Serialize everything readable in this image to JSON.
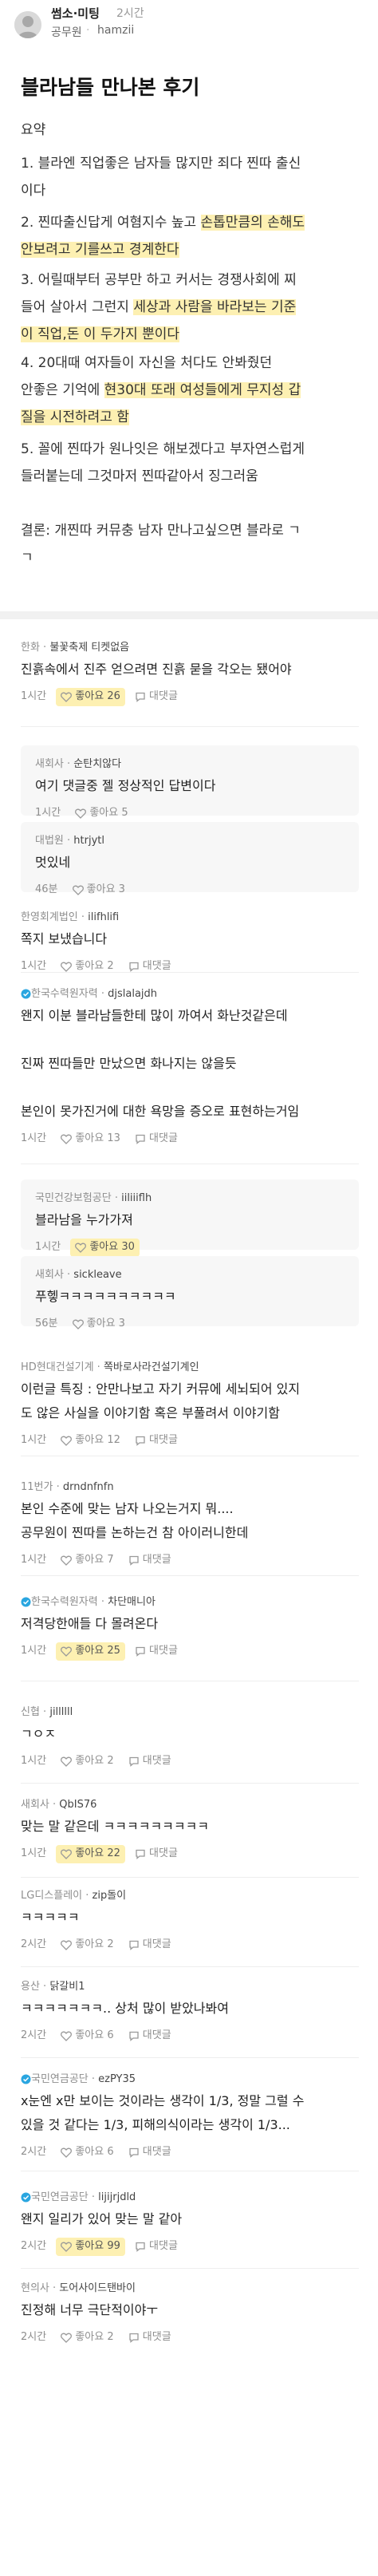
{
  "header": {
    "board": "썸소·미팅",
    "time": "2시간",
    "author_company": "공무원",
    "author_dot": "·",
    "author_name": "hamzii"
  },
  "post": {
    "title": "블라남들 만나본 후기",
    "summary_label": "요약",
    "lines": [
      "1. 블라엔 직업좋은 남자들 많지만 죄다 찐따 출신",
      "이다",
      "2. 찐따출신답게 여혐지수 높고 손톱만큼의 손해도",
      "안보려고 기를쓰고 경계한다",
      "3. 어릴때부터 공부만 하고 커서는 경쟁사회에 찌",
      "들어 살아서 그런지 세상과 사람을 바라보는 기준",
      "이 직업,돈 이 두가지 뿐이다",
      "4. 20대때 여자들이 자신을 처다도 안봐줬던",
      "안좋은 기억에 현30대 또래 여성들에게 무지성 갑",
      "질을 시전하려고 함",
      "5. 꼴에 찐따가 원나잇은 해보겠다고 부자연스럽게",
      "들러붙는데 그것마저 찐따같아서 징그러움",
      "",
      "결론: 개찐따 커뮤충 남자 만나고싶으면 블라로 ㄱ",
      "ㄱ"
    ]
  },
  "comments": [
    {
      "company": "한화",
      "name": "불꽃축제 티켓없음",
      "lines": [
        "진흙속에서 진주 얻으려면 진흙 묻을 각오는 됐어야"
      ],
      "time": "1시간",
      "likes": "좋아요 26",
      "liked": true,
      "reply": "대댓글",
      "is_reply": false
    },
    {
      "company": "새회사",
      "name": "순탄치않다",
      "lines": [
        "여기 댓글중 젤 정상적인 답변이다"
      ],
      "time": "1시간",
      "likes": "좋아요 5",
      "liked": false,
      "reply": "",
      "is_reply": true
    },
    {
      "company": "대법원",
      "name": "htrjytl",
      "lines": [
        "멋있네"
      ],
      "time": "46분",
      "likes": "좋아요 3",
      "liked": false,
      "reply": "",
      "is_reply": true
    },
    {
      "company": "한영회계법인",
      "name": "ilifhlifi",
      "lines": [
        "쪽지 보냈습니다"
      ],
      "time": "1시간",
      "likes": "좋아요 2",
      "liked": false,
      "reply": "대댓글",
      "is_reply": false
    },
    {
      "company": "한국수력원자력",
      "name": "djslalajdh",
      "lines": [
        "왠지 이분 블라남들한테 많이 까여서 화난것같은데",
        "",
        "진짜 찐따들만 만났으면 화나지는 않을듯",
        "",
        "본인이 못가진거에 대한 욕망을 증오로 표현하는거임"
      ],
      "time": "1시간",
      "likes": "좋아요 13",
      "liked": false,
      "reply": "대댓글",
      "is_reply": false
    },
    {
      "company": "국민건강보험공단",
      "name": "iiliiiflh",
      "lines": [
        "블라남을 누가가져"
      ],
      "time": "1시간",
      "likes": "좋아요 30",
      "liked": true,
      "reply": "",
      "is_reply": true
    },
    {
      "company": "새회사",
      "name": "sickleave",
      "lines": [
        "푸헿ㅋㅋㅋㅋㅋㅋㅋㅋㅋㅋ"
      ],
      "time": "56분",
      "likes": "좋아요 3",
      "liked": false,
      "reply": "",
      "is_reply": true
    },
    {
      "company": "HD현대건설기계",
      "name": "쪽바로사라건설기계인",
      "lines": [
        "이런글 특징 : 안만나보고 자기 커뮤에 세뇌되어 있지",
        "도 않은 사실을 이야기함 혹은 부풀려서 이야기함"
      ],
      "time": "1시간",
      "likes": "좋아요 12",
      "liked": false,
      "reply": "대댓글",
      "is_reply": false
    },
    {
      "company": "11번가",
      "name": "drndnfnfn",
      "lines": [
        "본인 수준에 맞는 남자 나오는거지 뭐....",
        "공무원이 찐따를 논하는건 참 아이러니한데"
      ],
      "time": "1시간",
      "likes": "좋아요 7",
      "liked": false,
      "reply": "대댓글",
      "is_reply": false
    },
    {
      "company": "한국수력원자력",
      "name": "차단매니아",
      "lines": [
        "저격당한애들 다 몰려온다"
      ],
      "time": "1시간",
      "likes": "좋아요 25",
      "liked": true,
      "reply": "대댓글",
      "is_reply": false
    },
    {
      "company": "신협",
      "name": "jillllll",
      "lines": [
        "ㄱㅇㅈ"
      ],
      "time": "1시간",
      "likes": "좋아요 2",
      "liked": false,
      "reply": "대댓글",
      "is_reply": false
    },
    {
      "company": "새회사",
      "name": "QbIS76",
      "lines": [
        "맞는 말 같은데 ㅋㅋㅋㅋㅋㅋㅋㅋㅋ"
      ],
      "time": "1시간",
      "likes": "좋아요 22",
      "liked": true,
      "reply": "대댓글",
      "is_reply": false
    },
    {
      "company": "LG디스플레이",
      "name": "zip돌이",
      "lines": [
        "ㅋㅋㅋㅋㅋ"
      ],
      "time": "2시간",
      "likes": "좋아요 2",
      "liked": false,
      "reply": "대댓글",
      "is_reply": false
    },
    {
      "company": "용산",
      "name": "닭갈비1",
      "lines": [
        "ㅋㅋㅋㅋㅋㅋㅋ.. 상처 많이 받았나봐여"
      ],
      "time": "2시간",
      "likes": "좋아요 6",
      "liked": false,
      "reply": "대댓글",
      "is_reply": false
    },
    {
      "company": "국민연금공단",
      "name": "ezPY35",
      "lines": [
        "x눈엔 x만 보이는 것이라는 생각이 1/3, 정말 그럴 수",
        "있을 것 같다는 1/3, 피해의식이라는 생각이 1/3..."
      ],
      "time": "2시간",
      "likes": "좋아요 6",
      "liked": false,
      "reply": "대댓글",
      "is_reply": false
    },
    {
      "company": "국민연금공단",
      "name": "lijijrjdld",
      "lines": [
        "왠지 일리가 있어 맞는 말 같아"
      ],
      "time": "2시간",
      "likes": "좋아요 99",
      "liked": true,
      "reply": "대댓글",
      "is_reply": false
    },
    {
      "company": "현의사",
      "name": "도어사이드탠바이",
      "lines": [
        "진정해 너무 극단적이야ㅜ"
      ],
      "time": "2시간",
      "likes": "좋아요 2",
      "liked": false,
      "reply": "대댓글",
      "is_reply": false
    }
  ],
  "colors": {
    "highlight": "#fdf0b2",
    "text": "#222222",
    "muted": "#8e8e8e",
    "reply_bg": "#f7f7f7"
  },
  "icons": {
    "avatar": "person-avatar-icon",
    "badge": "verified-badge-icon",
    "like": "heart-icon",
    "reply": "reply-comment-icon"
  }
}
